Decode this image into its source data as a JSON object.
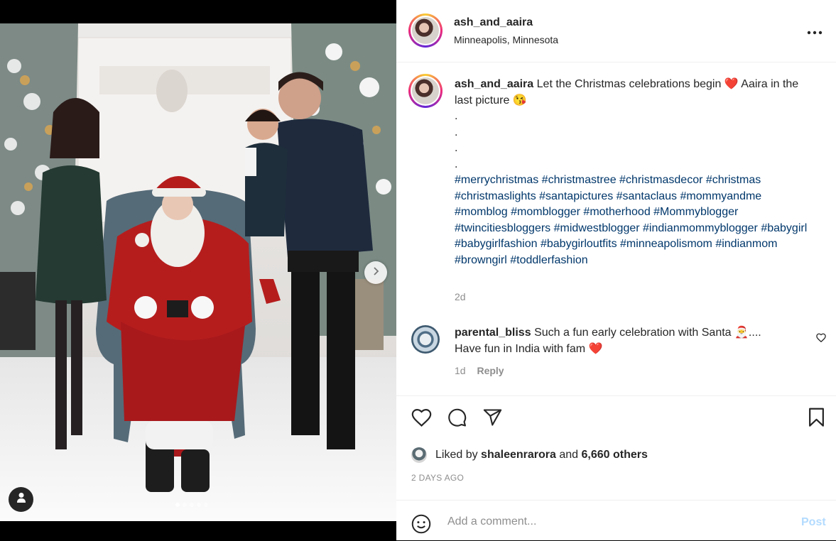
{
  "post": {
    "author": "ash_and_aaira",
    "location": "Minneapolis, Minnesota",
    "more_icon": "more-horizontal-icon",
    "caption_text": "Let the Christmas celebrations begin ❤️ Aaira in the last picture 😘",
    "caption_dots": [
      ".",
      ".",
      ".",
      "."
    ],
    "hashtags": "#merrychristmas #christmastree #christmasdecor #christmas #christmaslights #santapictures #santaclaus #mommyandme #momblog #momblogger #motherhood #Mommyblogger #twincitiesbloggers #midwestblogger #indianmommyblogger #babygirl #babygirlfashion #babygirloutfits #minneapolismom #indianmom #browngirl #toddlerfashion",
    "caption_time": "2d"
  },
  "comment": {
    "author": "parental_bliss",
    "text": "Such a fun early celebration with Santa 🎅.... Have fun in India with fam ❤️",
    "time": "1d",
    "reply_label": "Reply"
  },
  "likes": {
    "prefix": "Liked by",
    "user": "shaleenrarora",
    "and": "and",
    "others": "6,660 others"
  },
  "date": "2 DAYS AGO",
  "add_comment": {
    "placeholder": "Add a comment...",
    "post_label": "Post"
  },
  "carousel": {
    "count": 5,
    "active_index": 0
  },
  "colors": {
    "hashtag": "#00376b",
    "post_button": "#b3dbff",
    "muted": "#8e8e8e"
  }
}
